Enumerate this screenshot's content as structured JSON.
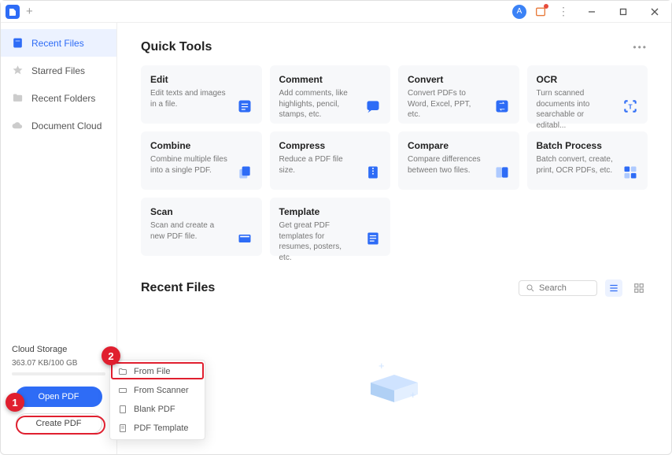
{
  "titlebar": {
    "profile": "A"
  },
  "sidebar": {
    "items": [
      {
        "label": "Recent Files",
        "active": true
      },
      {
        "label": "Starred Files"
      },
      {
        "label": "Recent Folders"
      },
      {
        "label": "Document Cloud"
      }
    ],
    "cloud": {
      "title": "Cloud Storage",
      "stats": "363.07 KB/100 GB"
    },
    "open_btn": "Open PDF",
    "create_btn": "Create PDF"
  },
  "quick_tools": {
    "title": "Quick Tools",
    "cards": [
      {
        "title": "Edit",
        "desc": "Edit texts and images in a file."
      },
      {
        "title": "Comment",
        "desc": "Add comments, like highlights, pencil, stamps, etc."
      },
      {
        "title": "Convert",
        "desc": "Convert PDFs to Word, Excel, PPT, etc."
      },
      {
        "title": "OCR",
        "desc": "Turn scanned documents into searchable or editabl..."
      },
      {
        "title": "Combine",
        "desc": "Combine multiple files into a single PDF."
      },
      {
        "title": "Compress",
        "desc": "Reduce a PDF file size."
      },
      {
        "title": "Compare",
        "desc": "Compare differences between two files."
      },
      {
        "title": "Batch Process",
        "desc": "Batch convert, create, print, OCR PDFs, etc."
      },
      {
        "title": "Scan",
        "desc": "Scan and create a new PDF file."
      },
      {
        "title": "Template",
        "desc": "Get great PDF templates for resumes, posters, etc."
      }
    ]
  },
  "recent": {
    "title": "Recent Files",
    "search_placeholder": "Search"
  },
  "context_menu": {
    "items": [
      {
        "label": "From File"
      },
      {
        "label": "From Scanner"
      },
      {
        "label": "Blank PDF"
      },
      {
        "label": "PDF Template"
      }
    ]
  },
  "callouts": {
    "one": "1",
    "two": "2"
  }
}
